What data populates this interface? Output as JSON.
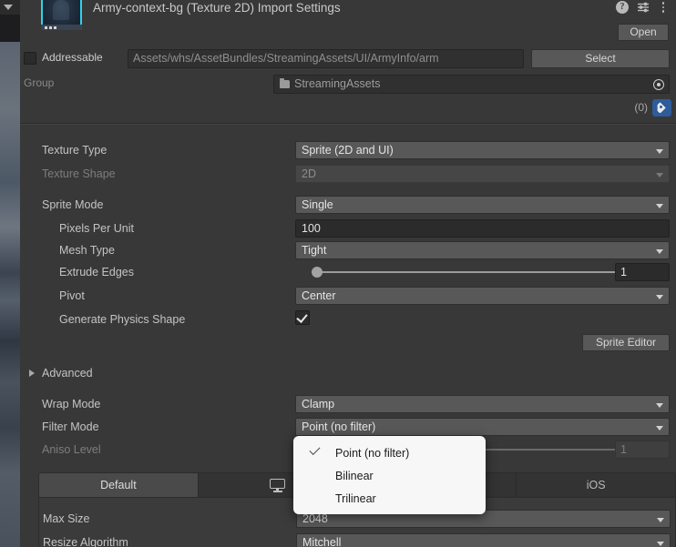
{
  "window": {
    "title": "Army-context-bg (Texture 2D) Import Settings",
    "header_icons": [
      {
        "name": "help-icon",
        "glyph": "?"
      },
      {
        "name": "preset-icon",
        "glyph": "preset"
      },
      {
        "name": "kebab-menu-icon",
        "glyph": "dots"
      }
    ],
    "open_button": "Open"
  },
  "addressable": {
    "label": "Addressable",
    "checked": false,
    "path_value": "Assets/whs/AssetBundles/StreamingAssets/UI/ArmyInfo/arm",
    "select_button": "Select",
    "group_label": "Group",
    "group_value": "StreamingAssets",
    "labels_count": "(0)"
  },
  "import_settings": {
    "rows": [
      {
        "name": "texture-type",
        "label": "Texture Type",
        "indent": 0,
        "control": "dropdown",
        "value": "Sprite (2D and UI)",
        "disabled": false
      },
      {
        "name": "texture-shape",
        "label": "Texture Shape",
        "indent": 0,
        "control": "dropdown",
        "value": "2D",
        "disabled": true
      },
      {
        "name": "sprite-mode",
        "label": "Sprite Mode",
        "indent": 0,
        "control": "dropdown",
        "value": "Single",
        "disabled": false
      },
      {
        "name": "pixels-per-unit",
        "label": "Pixels Per Unit",
        "indent": 1,
        "control": "text",
        "value": "100",
        "disabled": false
      },
      {
        "name": "mesh-type",
        "label": "Mesh Type",
        "indent": 1,
        "control": "dropdown",
        "value": "Tight",
        "disabled": false
      },
      {
        "name": "extrude-edges",
        "label": "Extrude Edges",
        "indent": 1,
        "control": "slider",
        "value": "1",
        "disabled": false
      },
      {
        "name": "pivot",
        "label": "Pivot",
        "indent": 1,
        "control": "dropdown",
        "value": "Center",
        "disabled": false
      },
      {
        "name": "generate-physics-shape",
        "label": "Generate Physics Shape",
        "indent": 1,
        "control": "checkbox",
        "value": "true",
        "disabled": false
      }
    ],
    "sprite_editor_button": "Sprite Editor",
    "advanced_foldout": "Advanced",
    "advanced_rows": [
      {
        "name": "wrap-mode",
        "label": "Wrap Mode",
        "indent": 0,
        "control": "dropdown",
        "value": "Clamp",
        "disabled": false
      },
      {
        "name": "filter-mode",
        "label": "Filter Mode",
        "indent": 0,
        "control": "dropdown",
        "value": "Point (no filter)",
        "disabled": false
      },
      {
        "name": "aniso-level",
        "label": "Aniso Level",
        "indent": 0,
        "control": "slider",
        "value": "1",
        "disabled": true
      }
    ]
  },
  "platform": {
    "tabs": [
      {
        "name": "tab-default",
        "label": "Default",
        "icon": "",
        "active": true
      },
      {
        "name": "tab-standalone",
        "label": "",
        "icon": "monitor-icon",
        "active": false
      },
      {
        "name": "tab-android",
        "label": "",
        "icon": "android-icon",
        "active": false
      },
      {
        "name": "tab-ios",
        "label": "iOS",
        "icon": "",
        "active": false
      }
    ],
    "rows": [
      {
        "name": "max-size",
        "label": "Max Size",
        "control": "dropdown",
        "value": "2048",
        "disabled": false
      },
      {
        "name": "resize-algorithm",
        "label": "Resize Algorithm",
        "control": "dropdown",
        "value": "Mitchell",
        "disabled": false
      }
    ]
  },
  "filter_mode_popup": {
    "open": true,
    "selected": "Point (no filter)",
    "options": [
      {
        "label": "Point (no filter)",
        "checked": true
      },
      {
        "label": "Bilinear",
        "checked": false
      },
      {
        "label": "Trilinear",
        "checked": false
      }
    ]
  },
  "colors": {
    "panel_bg": "#383838",
    "field_bg": "#585858",
    "input_bg": "#2b2b2b",
    "text": "#c4c4c4",
    "text_dim": "#7d7d7d",
    "accent_blue": "#2c5c9c",
    "popup_bg": "#f7f7f7",
    "tab_active": "#4a4a4a"
  }
}
